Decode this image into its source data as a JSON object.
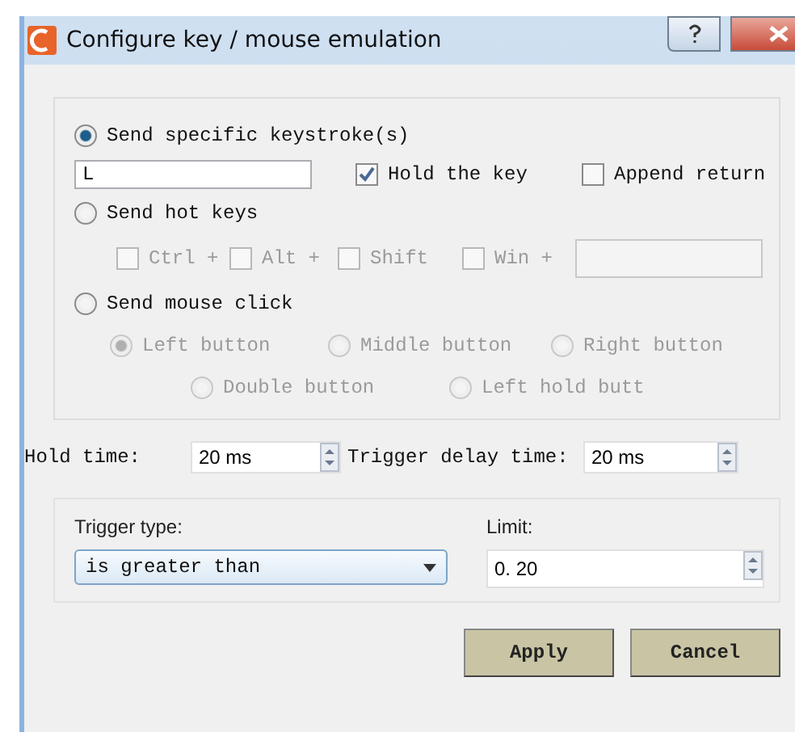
{
  "window": {
    "title": "Configure key / mouse emulation"
  },
  "modes": [
    {
      "label": "Send specific keystroke(s)",
      "selected": true
    },
    {
      "label": "Send hot keys",
      "selected": false
    },
    {
      "label": "Send mouse click",
      "selected": false
    }
  ],
  "keystroke": {
    "value": "L",
    "options": [
      {
        "label": "Hold the key",
        "checked": true
      },
      {
        "label": "Append return",
        "checked": false
      }
    ]
  },
  "hotkeys": {
    "disabled": true,
    "modifiers": [
      {
        "label": "Ctrl +",
        "checked": false
      },
      {
        "label": "Alt +",
        "checked": false
      },
      {
        "label": "Shift",
        "checked": false
      },
      {
        "label": "Win +",
        "checked": false
      }
    ]
  },
  "mouse_buttons": {
    "disabled": true,
    "options": [
      {
        "label": "Left button",
        "selected": true
      },
      {
        "label": "Middle button",
        "selected": false
      },
      {
        "label": "Right button",
        "selected": false
      },
      {
        "label": "Double button",
        "selected": false
      },
      {
        "label": "Left hold butt",
        "selected": false
      }
    ]
  },
  "hold_time": {
    "label": "Hold time:",
    "value": "20 ms"
  },
  "trigger_delay": {
    "label": "Trigger delay time:",
    "value": "20 ms"
  },
  "trigger_type": {
    "label": "Trigger type:",
    "value": "is greater than"
  },
  "limit": {
    "label": "Limit:",
    "value": "0. 20"
  },
  "buttons": [
    {
      "label": "Apply"
    },
    {
      "label": "Cancel"
    }
  ]
}
